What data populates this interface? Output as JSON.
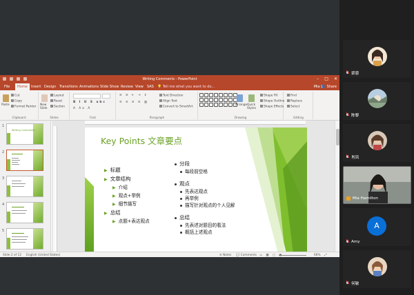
{
  "ppt": {
    "window_title": "Writing Comments - PowerPoint",
    "user_short": "Mia L",
    "share_label": "Share",
    "tabs": [
      "File",
      "Home",
      "Insert",
      "Design",
      "Transitions",
      "Animations",
      "Slide Show",
      "Review",
      "View",
      "SAS"
    ],
    "tell_me": "Tell me what you want to do...",
    "ribbon": {
      "paste": "Paste",
      "cut": "Cut",
      "copy": "Copy",
      "format_painter": "Format Painter",
      "clipboard": "Clipboard",
      "new_slide": "New\nSlide",
      "layout": "Layout",
      "reset": "Reset",
      "section": "Section",
      "slides": "Slides",
      "font": "Font",
      "text_direction": "Text Direction",
      "align_text": "Align Text",
      "convert_smartart": "Convert to SmartArt",
      "paragraph": "Paragraph",
      "arrange": "Arrange",
      "quick_styles": "Quick\nStyles",
      "shape_fill": "Shape Fill",
      "shape_outline": "Shape Outline",
      "shape_effects": "Shape Effects",
      "drawing": "Drawing",
      "find": "Find",
      "replace": "Replace",
      "select": "Select",
      "editing": "Editing"
    },
    "slide_numbers": [
      "1",
      "2",
      "3",
      "4",
      "5"
    ],
    "status": {
      "slide_of": "Slide 2 of 12",
      "language": "English (United States)",
      "notes": "Notes",
      "comments": "Comments",
      "zoom": "66%"
    },
    "slide": {
      "title": "Key Points 文章要点",
      "left": [
        {
          "text": "标题",
          "level": 1
        },
        {
          "text": "文章结构",
          "level": 1
        },
        {
          "text": "介绍",
          "level": 2
        },
        {
          "text": "观点+举例",
          "level": 2
        },
        {
          "text": "细节描写",
          "level": 2
        },
        {
          "text": "总结",
          "level": 1
        },
        {
          "text": "点题+表达观点",
          "level": 2
        }
      ],
      "right": [
        {
          "text": "分段",
          "level": 1
        },
        {
          "text": "每段前空格",
          "level": 2
        },
        {
          "text": "观点",
          "level": 1
        },
        {
          "text": "先表达观点",
          "level": 2
        },
        {
          "text": "再举例",
          "level": 2
        },
        {
          "text": "描写针对观点的个人见解",
          "level": 2
        },
        {
          "text": "总结",
          "level": 1
        },
        {
          "text": "先表述对题目的看法",
          "level": 2
        },
        {
          "text": "概括上述观点",
          "level": 2
        }
      ]
    },
    "thumb1_title": "Writing Comments"
  },
  "participants": [
    {
      "name": "梁恩",
      "type": "avatar-girl",
      "muted": true
    },
    {
      "name": "陈黎",
      "type": "avatar-landscape",
      "muted": true
    },
    {
      "name": "肖凤",
      "type": "avatar-girl2",
      "muted": true
    },
    {
      "name": "Mia Hamilton",
      "type": "camera",
      "muted": false
    },
    {
      "name": "Amy",
      "type": "letter",
      "letter": "A",
      "muted": true
    },
    {
      "name": "何敏",
      "type": "avatar-girl3",
      "muted": true
    }
  ],
  "colors": {
    "ppt_accent": "#b7472a",
    "slide_green": "#6aa124",
    "zoom_letter_bg": "#0b6fd8"
  }
}
